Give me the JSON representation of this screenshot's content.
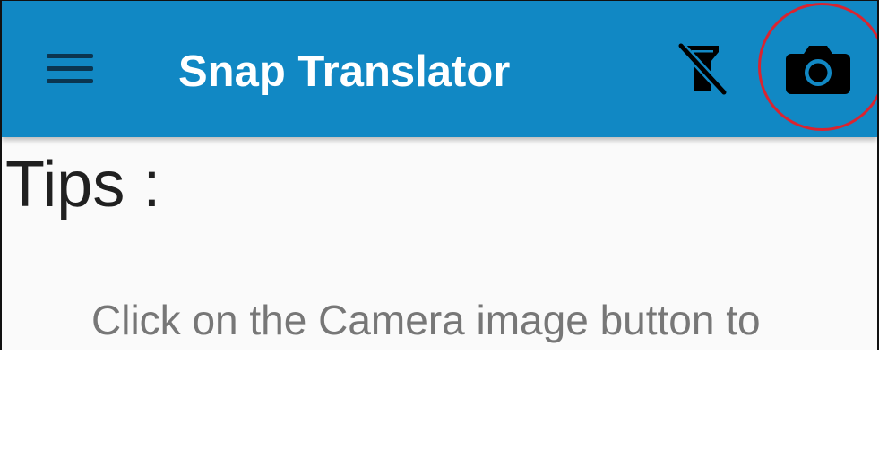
{
  "app_bar": {
    "title": "Snap Translator",
    "background_color": "#1188c4",
    "menu_icon": "hamburger-menu-icon",
    "flash_icon": "flash-off-icon",
    "camera_icon": "camera-icon",
    "camera_highlight_color": "#d92430"
  },
  "content": {
    "heading": "Tips :",
    "tip_text": "Click on the Camera image button to"
  }
}
